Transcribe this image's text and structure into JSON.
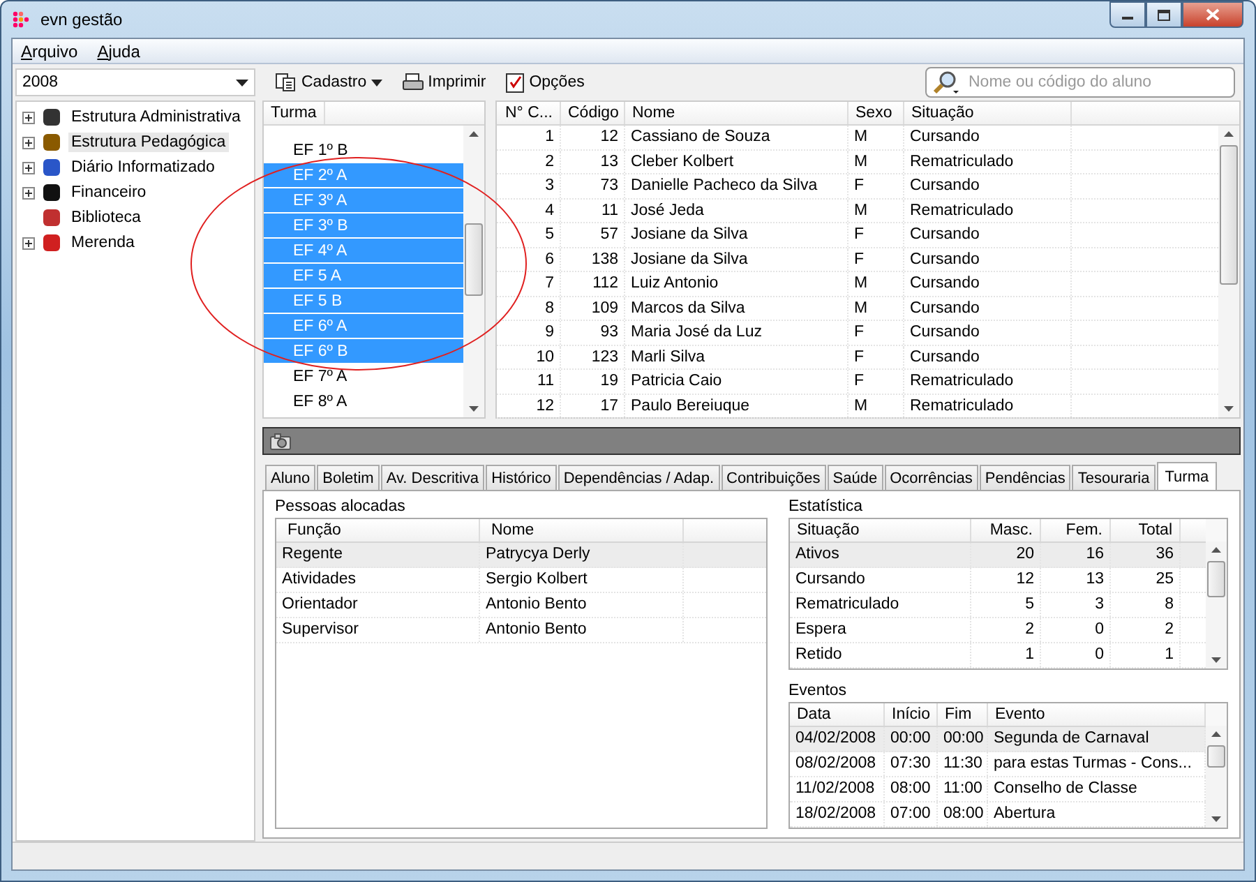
{
  "window": {
    "title": "evn gestão"
  },
  "menu": [
    {
      "label": "Arquivo"
    },
    {
      "label": "Ajuda"
    }
  ],
  "year_select": {
    "value": "2008"
  },
  "toolbar": [
    {
      "label": "Cadastro",
      "kind": "dropdown"
    },
    {
      "label": "Imprimir",
      "kind": "button"
    },
    {
      "label": "Opções",
      "kind": "button"
    }
  ],
  "search": {
    "placeholder": "Nome ou código do aluno"
  },
  "tree": [
    {
      "label": "Estrutura Administrativa",
      "expandable": true,
      "selected": false
    },
    {
      "label": "Estrutura Pedagógica",
      "expandable": true,
      "selected": true
    },
    {
      "label": "Diário Informatizado",
      "expandable": true,
      "selected": false
    },
    {
      "label": "Financeiro",
      "expandable": true,
      "selected": false
    },
    {
      "label": "Biblioteca",
      "expandable": false,
      "selected": false
    },
    {
      "label": "Merenda",
      "expandable": true,
      "selected": false
    }
  ],
  "turma_list": {
    "header": "Turma",
    "items": [
      {
        "label": "EF 1º B",
        "selected": false
      },
      {
        "label": "EF 2º A",
        "selected": true
      },
      {
        "label": "EF 3º A",
        "selected": true
      },
      {
        "label": "EF 3º B",
        "selected": true
      },
      {
        "label": "EF 4º A",
        "selected": true
      },
      {
        "label": "EF 5 A",
        "selected": true
      },
      {
        "label": "EF 5 B",
        "selected": true
      },
      {
        "label": "EF 6º A",
        "selected": true
      },
      {
        "label": "EF 6º B",
        "selected": true
      },
      {
        "label": "EF 7º A",
        "selected": false
      },
      {
        "label": "EF 8º A",
        "selected": false
      }
    ]
  },
  "students": {
    "columns": [
      "N° C...",
      "Código",
      "Nome",
      "Sexo",
      "Situação"
    ],
    "rows": [
      [
        "1",
        "12",
        "Cassiano de Souza",
        "M",
        "Cursando"
      ],
      [
        "2",
        "13",
        "Cleber Kolbert",
        "M",
        "Rematriculado"
      ],
      [
        "3",
        "73",
        "Danielle Pacheco da Silva",
        "F",
        "Cursando"
      ],
      [
        "4",
        "11",
        "José Jeda",
        "M",
        "Rematriculado"
      ],
      [
        "5",
        "57",
        "Josiane da Silva",
        "F",
        "Cursando"
      ],
      [
        "6",
        "138",
        "Josiane da Silva",
        "F",
        "Cursando"
      ],
      [
        "7",
        "112",
        "Luiz Antonio",
        "M",
        "Cursando"
      ],
      [
        "8",
        "109",
        "Marcos da Silva",
        "M",
        "Cursando"
      ],
      [
        "9",
        "93",
        "Maria José da Luz",
        "F",
        "Cursando"
      ],
      [
        "10",
        "123",
        "Marli Silva",
        "F",
        "Cursando"
      ],
      [
        "11",
        "19",
        "Patricia Caio",
        "F",
        "Rematriculado"
      ],
      [
        "12",
        "17",
        "Paulo Bereiuque",
        "M",
        "Rematriculado"
      ]
    ]
  },
  "tabs": [
    {
      "label": "Aluno",
      "selected": false
    },
    {
      "label": "Boletim",
      "selected": false
    },
    {
      "label": "Av. Descritiva",
      "selected": false
    },
    {
      "label": "Histórico",
      "selected": false
    },
    {
      "label": "Dependências / Adap.",
      "selected": false
    },
    {
      "label": "Contribuições",
      "selected": false
    },
    {
      "label": "Saúde",
      "selected": false
    },
    {
      "label": "Ocorrências",
      "selected": false
    },
    {
      "label": "Pendências",
      "selected": false
    },
    {
      "label": "Tesouraria",
      "selected": false
    },
    {
      "label": "Turma",
      "selected": true
    }
  ],
  "pessoas": {
    "title": "Pessoas alocadas",
    "columns": [
      "Função",
      "Nome"
    ],
    "rows": [
      {
        "cells": [
          "Regente",
          "Patrycya Derly"
        ],
        "selected": true
      },
      {
        "cells": [
          "Atividades",
          "Sergio Kolbert"
        ],
        "selected": false
      },
      {
        "cells": [
          "Orientador",
          "Antonio Bento"
        ],
        "selected": false
      },
      {
        "cells": [
          "Supervisor",
          "Antonio Bento"
        ],
        "selected": false
      }
    ]
  },
  "estatistica": {
    "title": "Estatística",
    "columns": [
      "Situação",
      "Masc.",
      "Fem.",
      "Total"
    ],
    "rows": [
      {
        "cells": [
          "Ativos",
          "20",
          "16",
          "36"
        ],
        "selected": true
      },
      {
        "cells": [
          "Cursando",
          "12",
          "13",
          "25"
        ],
        "selected": false
      },
      {
        "cells": [
          "Rematriculado",
          "5",
          "3",
          "8"
        ],
        "selected": false
      },
      {
        "cells": [
          "Espera",
          "2",
          "0",
          "2"
        ],
        "selected": false
      },
      {
        "cells": [
          "Retido",
          "1",
          "0",
          "1"
        ],
        "selected": false
      }
    ]
  },
  "eventos": {
    "title": "Eventos",
    "columns": [
      "Data",
      "Início",
      "Fim",
      "Evento"
    ],
    "rows": [
      {
        "cells": [
          "04/02/2008",
          "00:00",
          "00:00",
          "Segunda de Carnaval"
        ],
        "selected": true
      },
      {
        "cells": [
          "08/02/2008",
          "07:30",
          "11:30",
          "para estas Turmas - Cons..."
        ],
        "selected": false
      },
      {
        "cells": [
          "11/02/2008",
          "08:00",
          "11:00",
          "Conselho de Classe"
        ],
        "selected": false
      },
      {
        "cells": [
          "18/02/2008",
          "07:00",
          "08:00",
          "Abertura"
        ],
        "selected": false
      }
    ]
  }
}
